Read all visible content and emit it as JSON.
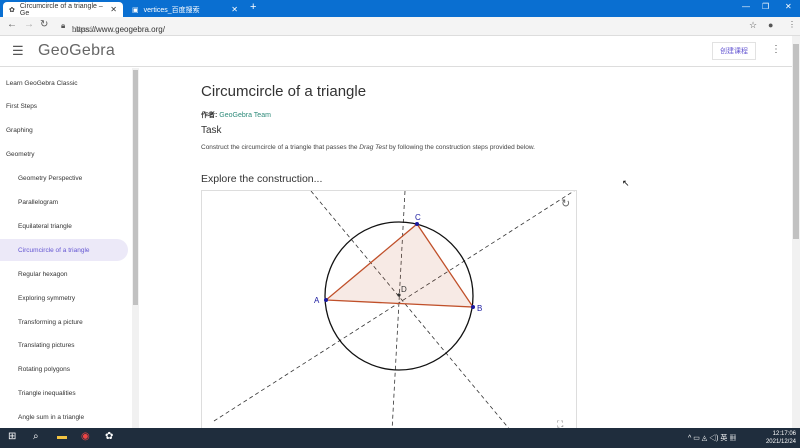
{
  "browser": {
    "tabs": [
      {
        "label": "Circumcircle of a triangle – Ge",
        "active": true
      },
      {
        "label": "vertices_百度搜索",
        "active": false
      }
    ],
    "url_main": "https://www.geogebra.org/",
    "url_path": "classic"
  },
  "header": {
    "logo": "GeoGebra",
    "create_button": "创建课程"
  },
  "sidebar": {
    "items": [
      {
        "label": "Learn GeoGebra Classic",
        "level": 0
      },
      {
        "label": "First Steps",
        "level": 0
      },
      {
        "label": "Graphing",
        "level": 0
      },
      {
        "label": "Geometry",
        "level": 0
      },
      {
        "label": "Geometry Perspective",
        "level": 1
      },
      {
        "label": "Parallelogram",
        "level": 1
      },
      {
        "label": "Equilateral triangle",
        "level": 1
      },
      {
        "label": "Circumcircle of a triangle",
        "level": 1,
        "active": true
      },
      {
        "label": "Regular hexagon",
        "level": 1
      },
      {
        "label": "Exploring symmetry",
        "level": 1
      },
      {
        "label": "Transforming a picture",
        "level": 1
      },
      {
        "label": "Translating pictures",
        "level": 1
      },
      {
        "label": "Rotating polygons",
        "level": 1
      },
      {
        "label": "Triangle inequalities",
        "level": 1
      },
      {
        "label": "Angle sum in a triangle",
        "level": 1
      }
    ]
  },
  "main": {
    "title": "Circumcircle of a triangle",
    "author_label": "作者:",
    "author": "GeoGebra Team",
    "task_heading": "Task",
    "desc_before": "Construct the circumcircle of a triangle that passes the ",
    "desc_em": "Drag Test",
    "desc_after": " by following the construction steps provided below.",
    "explore": "Explore the construction..."
  },
  "applet": {
    "points": {
      "A": "A",
      "B": "B",
      "C": "C",
      "D": "D"
    },
    "colors": {
      "triangle": "#c0502a",
      "point": "#1a1aa0"
    }
  },
  "taskbar": {
    "time": "12:17:06",
    "date": "2021/12/24"
  }
}
